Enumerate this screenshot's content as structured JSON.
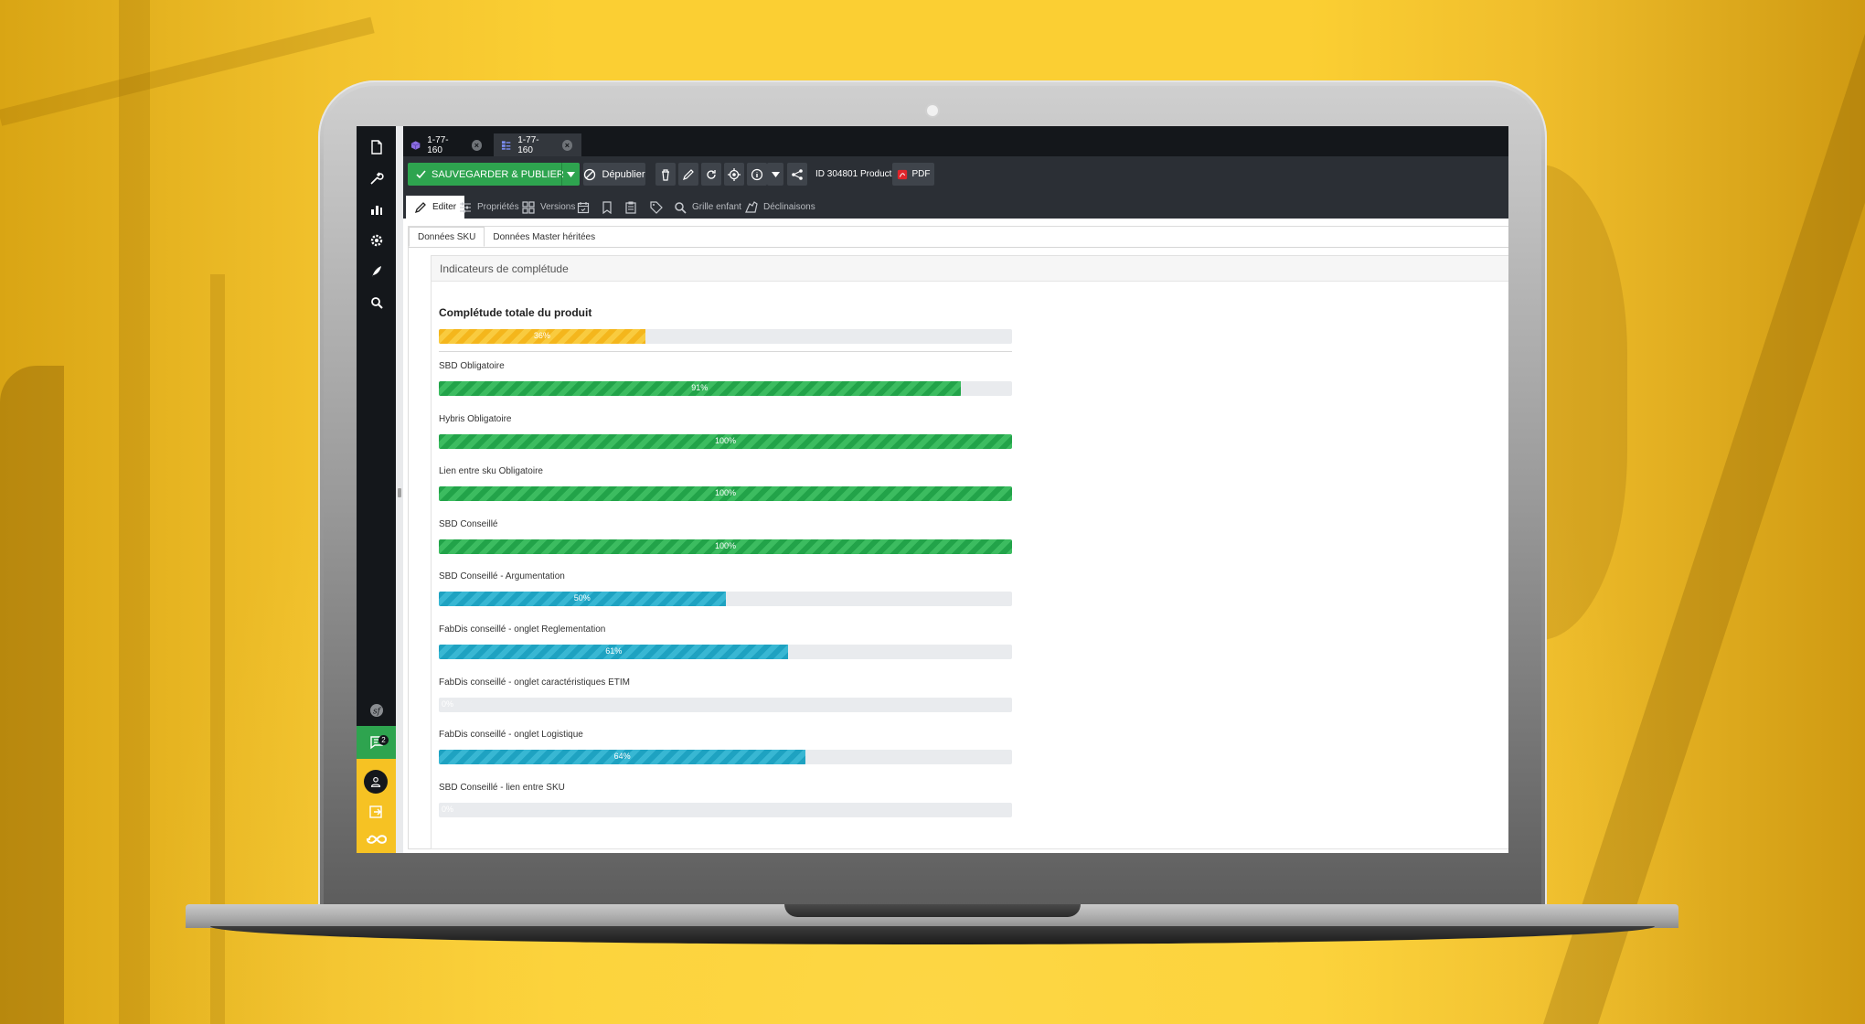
{
  "tabs": [
    {
      "label": "1-77-160",
      "icon": "cube-icon"
    },
    {
      "label": "1-77-160",
      "icon": "variant-list-icon"
    }
  ],
  "toolbar": {
    "save_label": "SAUVEGARDER & PUBLIER",
    "unpublish_label": "Dépublier",
    "id_label": "ID 304801",
    "type_label": "Product",
    "pdf_label": "PDF"
  },
  "subtabs": {
    "edit": "Editer",
    "properties": "Propriétés",
    "versions": "Versions",
    "child_grid": "Grille enfant",
    "variants": "Déclinaisons"
  },
  "inner_tabs": [
    "Données SKU",
    "Données Master héritées"
  ],
  "panel_title": "Indicateurs de complétude",
  "total": {
    "label": "Complétude totale du produit",
    "value": 36,
    "text": "36%",
    "color": "#f4b61c"
  },
  "indicators": [
    {
      "label": "SBD Obligatoire",
      "value": 91,
      "text": "91%",
      "color": "green"
    },
    {
      "label": "Hybris Obligatoire",
      "value": 100,
      "text": "100%",
      "color": "green"
    },
    {
      "label": "Lien entre sku Obligatoire",
      "value": 100,
      "text": "100%",
      "color": "green"
    },
    {
      "label": "SBD Conseillé",
      "value": 100,
      "text": "100%",
      "color": "green"
    },
    {
      "label": "SBD Conseillé - Argumentation",
      "value": 50,
      "text": "50%",
      "color": "blue"
    },
    {
      "label": "FabDis conseillé - onglet Reglementation",
      "value": 61,
      "text": "61%",
      "color": "blue"
    },
    {
      "label": "FabDis conseillé - onglet caractéristiques ETIM",
      "value": 0,
      "text": "0%",
      "color": "blue"
    },
    {
      "label": "FabDis conseillé - onglet Logistique",
      "value": 64,
      "text": "64%",
      "color": "blue"
    },
    {
      "label": "SBD Conseillé - lien entre SKU",
      "value": 0,
      "text": "0%",
      "color": "blue"
    }
  ],
  "sidebar": {
    "icons": [
      "document-icon",
      "wrench-icon",
      "bar-chart-icon",
      "gear-icon",
      "feather-icon",
      "search-icon"
    ],
    "notification_count": "2"
  },
  "colors": {
    "accent_green": "#2ea44f",
    "accent_yellow": "#f6c223",
    "background": "#fbcf33"
  }
}
